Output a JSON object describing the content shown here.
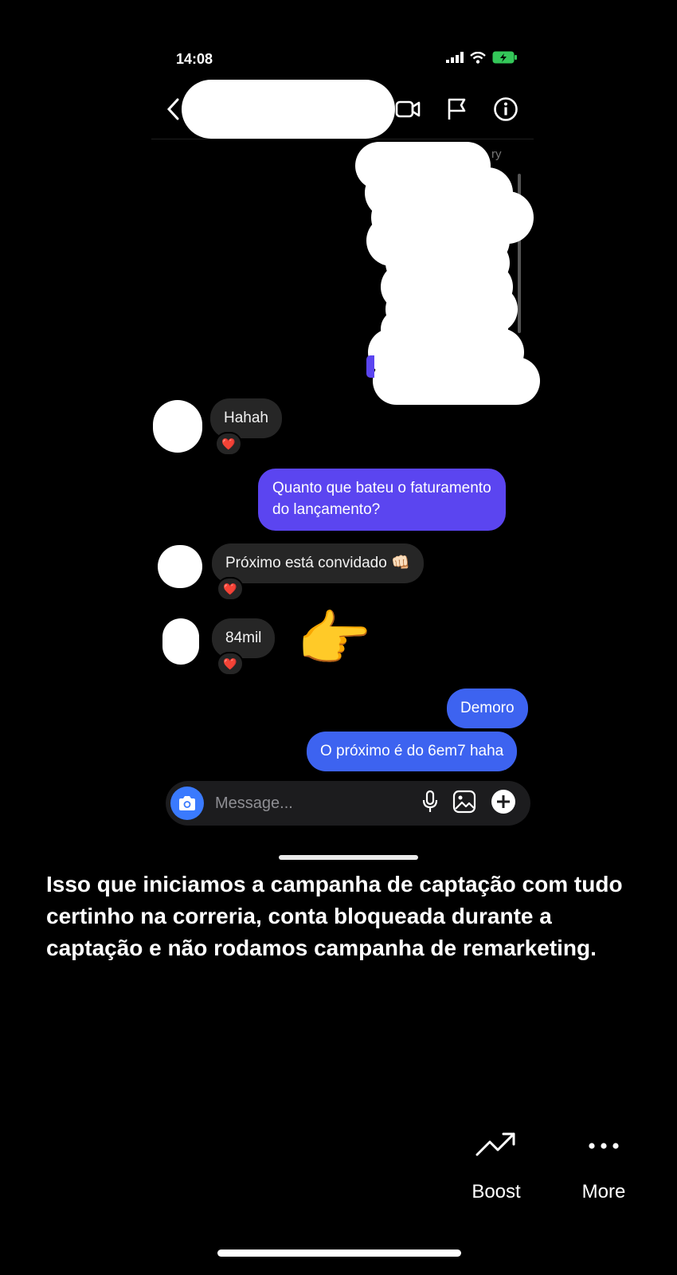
{
  "status_bar": {
    "time": "14:08"
  },
  "header": {
    "partial_text": "ry"
  },
  "messages": [
    {
      "id": "m1",
      "direction": "in",
      "text": "Hahah",
      "reaction": "❤️"
    },
    {
      "id": "m2",
      "direction": "out",
      "text_line1": "Quanto que bateu o faturamento",
      "text_line2": "do lançamento?"
    },
    {
      "id": "m3",
      "direction": "in",
      "text": "Próximo está convidado 👊🏻",
      "reaction": "❤️"
    },
    {
      "id": "m4",
      "direction": "in",
      "text": "84mil",
      "reaction": "❤️"
    },
    {
      "id": "m5",
      "direction": "out",
      "text": "Demoro"
    },
    {
      "id": "m6",
      "direction": "out",
      "text": "O próximo é do 6em7 haha"
    }
  ],
  "sticker": "👉",
  "composer": {
    "placeholder": "Message..."
  },
  "caption": "Isso que iniciamos a campanha de captação com tudo certinho na correria, conta bloqueada durante a captação e não rodamos campanha de remarketing.",
  "actions": {
    "boost_label": "Boost",
    "more_label": "More"
  },
  "colors": {
    "outgoing_purple": "#5b45f0",
    "outgoing_blue": "#3d63f0",
    "incoming": "#262626",
    "accent_blue": "#3a7afe"
  }
}
